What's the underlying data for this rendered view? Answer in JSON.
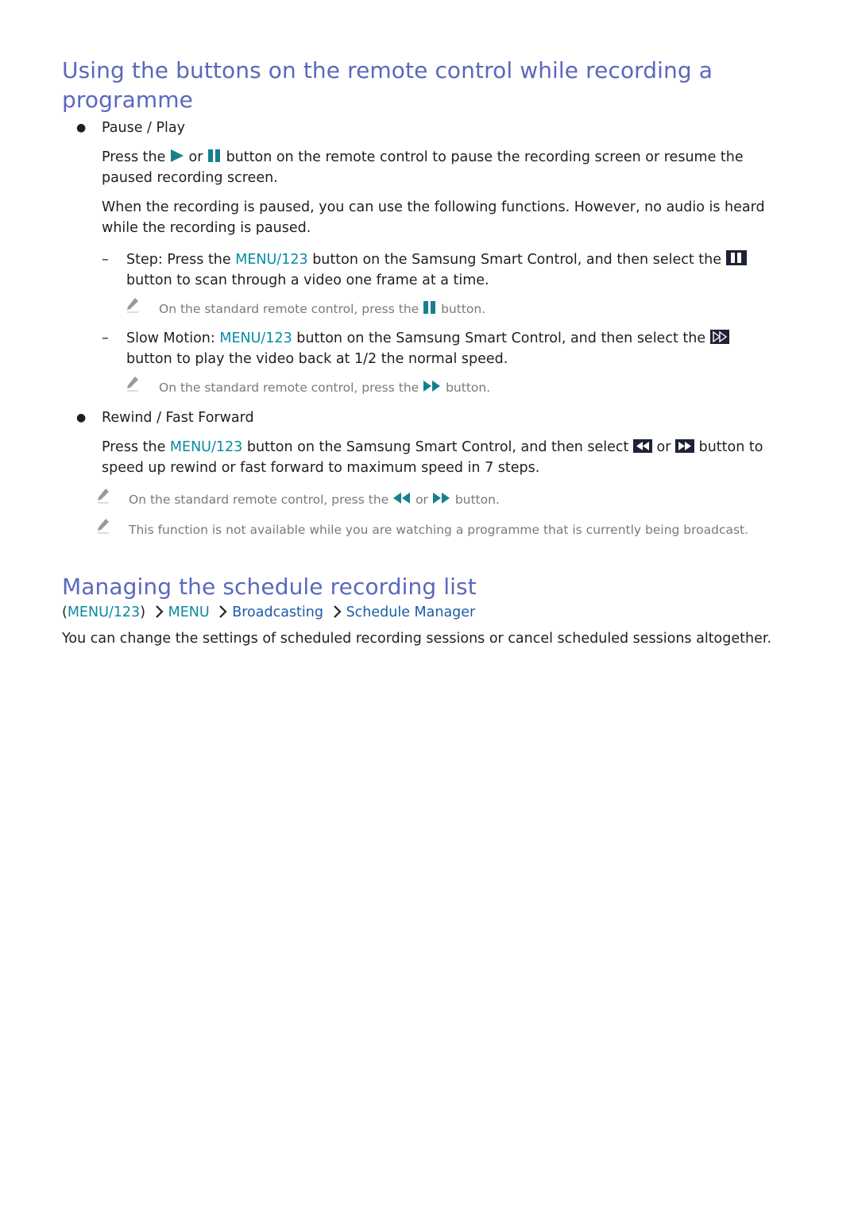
{
  "section1": {
    "title_line1": "Using the buttons on the remote control while recording a",
    "title_line2": "programme",
    "pause_play": {
      "heading": "Pause / Play",
      "p1_a": "Press the",
      "p1_or": "or",
      "p1_b": "button on the remote control to pause the recording screen or resume the",
      "p1_c": "paused recording screen.",
      "p2_a": "When the recording is paused, you can use the following functions. However, no audio is heard",
      "p2_b": "while the recording is paused.",
      "step": {
        "label": "Step:",
        "text_a": "Press the",
        "menu": "MENU/123",
        "text_b": "button on the Samsung Smart Control, and then select the",
        "text_c": "button to scan through a video one frame at a time.",
        "note_a": "On the standard remote control, press the",
        "note_b": "button."
      },
      "slow": {
        "label": "Slow Motion:",
        "menu": "MENU/123",
        "text_b": "button on the Samsung Smart Control, and then select the",
        "text_c": "button to play the video back at 1/2 the normal speed.",
        "note_a": "On the standard remote control, press the",
        "note_b": "button."
      }
    },
    "rewind_ff": {
      "heading": "Rewind / Fast Forward",
      "p_a": "Press the",
      "menu": "MENU/123",
      "p_b": "button on the Samsung Smart Control, and then select",
      "p_or": "or",
      "p_c": "button to",
      "p_d": "speed up rewind or fast forward to maximum speed in 7 steps."
    },
    "note1_a": "On the standard remote control, press the",
    "note1_or": "or",
    "note1_b": "button.",
    "note2": "This function is not available while you are watching a programme that is currently being broadcast."
  },
  "section2": {
    "title": "Managing the schedule recording list",
    "breadcrumb": {
      "open_paren": "(",
      "item0": "MENU/123",
      "close_paren": ")",
      "item1": "MENU",
      "item2": "Broadcasting",
      "item3": "Schedule Manager"
    },
    "body": "You can change the settings of scheduled recording sessions or cancel scheduled sessions altogether."
  },
  "colors": {
    "heading": "#5a68bd",
    "menu_teal": "#0a8aa5",
    "breadcrumb_navy": "#1a5ca6",
    "note_gray": "#7a7a7a",
    "icon_teal": "#17808c",
    "icon_dark": "#1e2236"
  }
}
